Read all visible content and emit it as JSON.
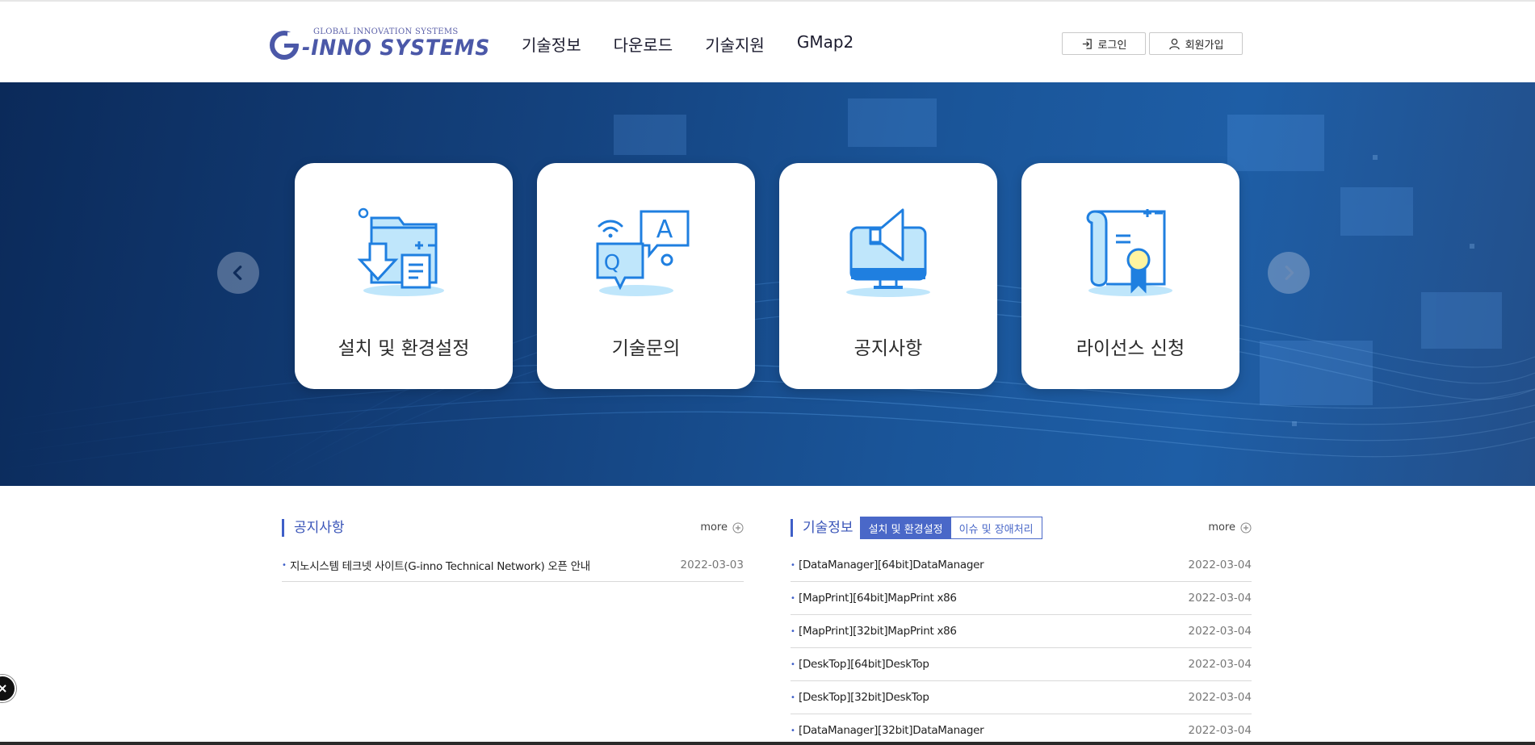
{
  "header": {
    "logo": {
      "small_text": "GLOBAL INNOVATION SYSTEMS",
      "big_text": "-INNO SYSTEMS",
      "mark": "G"
    },
    "nav": [
      "기술정보",
      "다운로드",
      "기술지원",
      "GMap2"
    ],
    "login_label": "로그인",
    "join_label": "회원가입"
  },
  "hero": {
    "cards": [
      {
        "label": "설치 및 환경설정",
        "icon": "folder-download-icon"
      },
      {
        "label": "기술문의",
        "icon": "qa-chat-icon"
      },
      {
        "label": "공지사항",
        "icon": "monitor-megaphone-icon"
      },
      {
        "label": "라이선스 신청",
        "icon": "certificate-icon"
      }
    ]
  },
  "notice": {
    "title": "공지사항",
    "more": "more",
    "items": [
      {
        "text": "지노시스템 테크넷 사이트(G-inno Technical Network) 오픈 안내",
        "date": "2022-03-03"
      }
    ]
  },
  "tech": {
    "title": "기술정보",
    "more": "more",
    "tabs": [
      "설치 및 환경설정",
      "이슈 및 장애처리"
    ],
    "items": [
      {
        "text": "[DataManager][64bit]DataManager",
        "date": "2022-03-04"
      },
      {
        "text": "[MapPrint][64bit]MapPrint x86",
        "date": "2022-03-04"
      },
      {
        "text": "[MapPrint][32bit]MapPrint x86",
        "date": "2022-03-04"
      },
      {
        "text": "[DeskTop][64bit]DeskTop",
        "date": "2022-03-04"
      },
      {
        "text": "[DeskTop][32bit]DeskTop",
        "date": "2022-03-04"
      },
      {
        "text": "[DataManager][32bit]DataManager",
        "date": "2022-03-04"
      }
    ]
  },
  "colors": {
    "accent": "#4a68c8",
    "hero_dark": "#0b2a5a",
    "icon_blue": "#1f7fe0",
    "icon_light": "#bfe6fb"
  }
}
